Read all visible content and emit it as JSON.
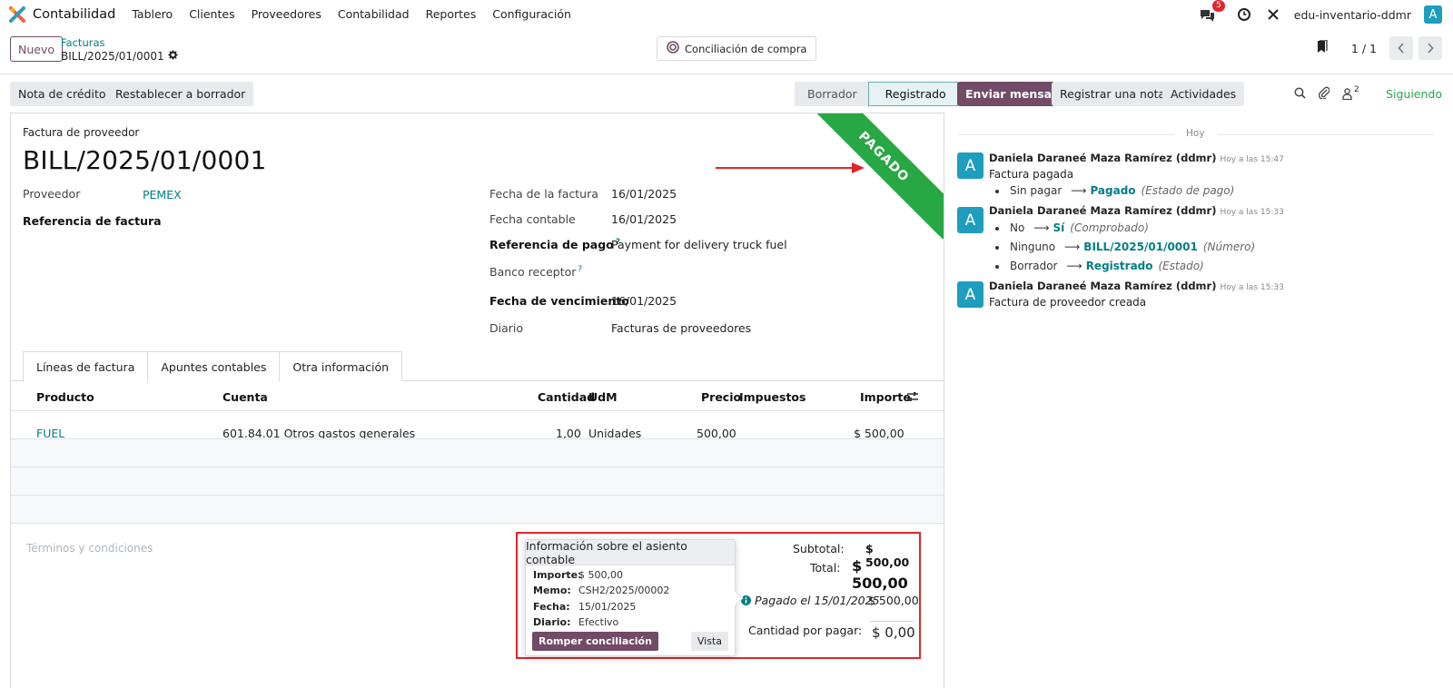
{
  "nav": {
    "app_name": "Contabilidad",
    "menu": [
      "Tablero",
      "Clientes",
      "Proveedores",
      "Contabilidad",
      "Reportes",
      "Configuración"
    ],
    "messages_badge": "5",
    "company": "edu-inventario-ddmr",
    "avatar_letter": "A"
  },
  "control": {
    "new_label": "Nuevo",
    "breadcrumb_parent": "Facturas",
    "breadcrumb_current": "BILL/2025/01/0001",
    "reconcile_label": "Conciliación de compra",
    "pager": "1 / 1"
  },
  "actions": {
    "credit_note": "Nota de crédito",
    "reset_draft": "Restablecer a borrador",
    "status_steps": [
      "Borrador",
      "Registrado"
    ],
    "status_active": "Registrado"
  },
  "form": {
    "doc_type": "Factura de proveedor",
    "number": "BILL/2025/01/0001",
    "ribbon": "PAGADO",
    "vendor_label": "Proveedor",
    "vendor_value": "PEMEX",
    "bill_ref_label": "Referencia de factura",
    "invoice_date_label": "Fecha de la factura",
    "invoice_date": "16/01/2025",
    "accounting_date_label": "Fecha contable",
    "accounting_date": "16/01/2025",
    "payment_ref_label": "Referencia de pago",
    "payment_ref": "Payment for delivery truck fuel",
    "bank_label": "Banco receptor",
    "due_date_label": "Fecha de vencimiento",
    "due_date": "16/01/2025",
    "journal_label": "Diario",
    "journal": "Facturas de proveedores",
    "help_mark": "?"
  },
  "tabs": [
    "Líneas de factura",
    "Apuntes contables",
    "Otra información"
  ],
  "lines": {
    "headers": [
      "Producto",
      "Cuenta",
      "Cantidad",
      "UdM",
      "Precio",
      "Impuestos",
      "Importe"
    ],
    "rows": [
      {
        "product": "FUEL",
        "account": "601.84.01 Otros gastos generales",
        "qty": "1,00",
        "uom": "Unidades",
        "price": "500,00",
        "taxes": "",
        "amount": "$ 500,00"
      }
    ]
  },
  "terms_placeholder": "Términos y condiciones",
  "totals": {
    "subtotal_label": "Subtotal:",
    "subtotal": "$ 500,00",
    "total_label": "Total:",
    "total": "$ 500,00",
    "paid_label": "Pagado el 15/01/2025",
    "paid_amount": "$ 500,00",
    "due_label": "Cantidad por pagar:",
    "due_amount": "$ 0,00"
  },
  "popover": {
    "title": "Información sobre el asiento contable",
    "amount_label": "Importe:",
    "amount": "$ 500,00",
    "memo_label": "Memo:",
    "memo": "CSH2/2025/00002",
    "date_label": "Fecha:",
    "date": "15/01/2025",
    "journal_label": "Diario:",
    "journal": "Efectivo",
    "break_label": "Romper conciliación",
    "view_label": "Vista"
  },
  "chatter": {
    "send_message": "Enviar mensaje",
    "log_note": "Registrar una nota",
    "activities": "Actividades",
    "followers_count": "2",
    "following": "Siguiendo",
    "day": "Hoy",
    "messages": [
      {
        "author": "Daniela Daraneé Maza Ramírez (ddmr)",
        "time": "Hoy a las 15:47",
        "text": "Factura pagada",
        "tracking": [
          {
            "from": "Sin pagar",
            "to": "Pagado",
            "field": "(Estado de pago)"
          }
        ]
      },
      {
        "author": "Daniela Daraneé Maza Ramírez (ddmr)",
        "time": "Hoy a las 15:33",
        "text": "",
        "tracking": [
          {
            "from": "No",
            "to": "Sí",
            "field": "(Comprobado)"
          },
          {
            "from": "Ninguno",
            "to": "BILL/2025/01/0001",
            "field": "(Número)"
          },
          {
            "from": "Borrador",
            "to": "Registrado",
            "field": "(Estado)"
          }
        ]
      },
      {
        "author": "Daniela Daraneé Maza Ramírez (ddmr)",
        "time": "Hoy a las 15:33",
        "text": "Factura de proveedor creada",
        "tracking": []
      }
    ]
  },
  "colors": {
    "brand_purple": "#714b67",
    "teal_link": "#017e84",
    "paid_green": "#28a745",
    "highlight_red": "#e3242b",
    "avatar_blue": "#1e9dbf"
  }
}
